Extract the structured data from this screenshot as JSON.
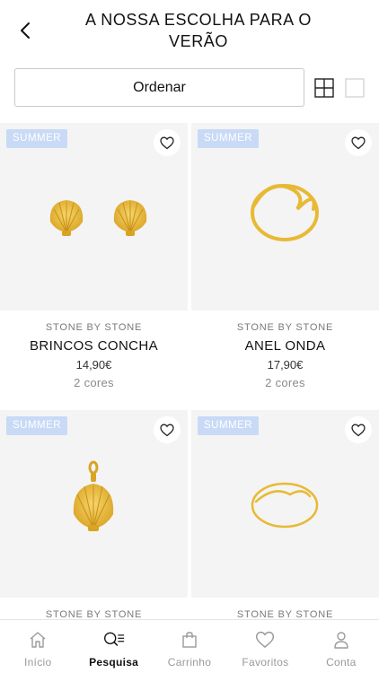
{
  "header": {
    "title_line1": "A NOSSA ESCOLHA PARA O",
    "title_line2": "VERÃO",
    "back_icon": "chevron-left-icon"
  },
  "toolbar": {
    "sort_label": "Ordenar",
    "grid_four_icon": "grid-four-icon",
    "grid_single_icon": "grid-single-icon"
  },
  "products": [
    {
      "badge": "SUMMER",
      "brand": "STONE BY STONE",
      "name": "BRINCOS CONCHA",
      "price": "14,90€",
      "colors": "2 cores",
      "art": "shell-earrings"
    },
    {
      "badge": "SUMMER",
      "brand": "STONE BY STONE",
      "name": "ANEL ONDA",
      "price": "17,90€",
      "colors": "2 cores",
      "art": "wave-ring"
    },
    {
      "badge": "SUMMER",
      "brand": "STONE BY STONE",
      "name": "",
      "price": "",
      "colors": "",
      "art": "shell-pendant"
    },
    {
      "badge": "SUMMER",
      "brand": "STONE BY STONE",
      "name": "",
      "price": "",
      "colors": "",
      "art": "wave-ring-thin"
    }
  ],
  "tabbar": {
    "items": [
      {
        "label": "Início",
        "icon": "home-icon",
        "active": false
      },
      {
        "label": "Pesquisa",
        "icon": "search-list-icon",
        "active": true
      },
      {
        "label": "Carrinho",
        "icon": "bag-icon",
        "active": false
      },
      {
        "label": "Favoritos",
        "icon": "heart-icon",
        "active": false
      },
      {
        "label": "Conta",
        "icon": "user-icon",
        "active": false
      }
    ]
  },
  "colors": {
    "badge_bg": "#c8daf6",
    "card_bg": "#f4f4f4",
    "gold": "#e8b934"
  }
}
